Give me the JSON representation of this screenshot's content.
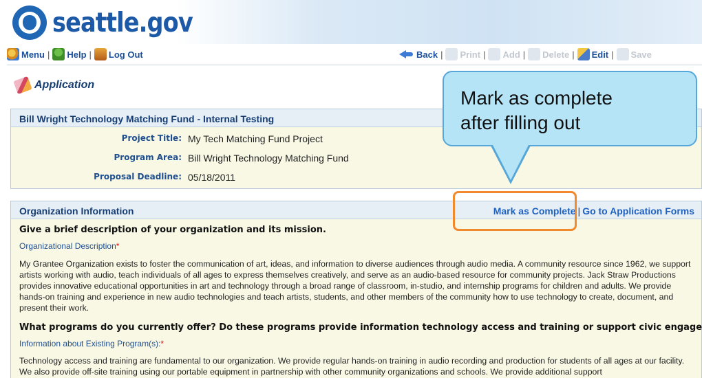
{
  "header": {
    "logo_text": "seattle.gov"
  },
  "toolbar": {
    "menu": "Menu",
    "help": "Help",
    "logout": "Log Out",
    "back": "Back",
    "print": "Print",
    "add": "Add",
    "delete": "Delete",
    "edit": "Edit",
    "save": "Save",
    "separator": "|"
  },
  "page": {
    "heading": "Application"
  },
  "project": {
    "title": "Bill Wright Technology Matching Fund - Internal Testing",
    "fields": [
      {
        "label": "Project Title:",
        "value": "My Tech Matching Fund Project"
      },
      {
        "label": "Program Area:",
        "value": "Bill Wright Technology Matching Fund"
      },
      {
        "label": "Proposal Deadline:",
        "value": "05/18/2011"
      }
    ]
  },
  "organization": {
    "title": "Organization Information",
    "mark_complete": "Mark as Complete",
    "link_separator": "|",
    "go_forms": "Go to Application Forms",
    "q1": "Give a brief description of your organization and its mission.",
    "q1_label": "Organizational Description",
    "required_mark": "*",
    "q1_text": "My Grantee Organization exists to foster the communication of art, ideas, and information to diverse audiences through audio media. A community resource since 1962, we support artists working with audio, teach individuals of all ages to express themselves creatively, and serve as an audio-based resource for community projects. Jack Straw Productions provides innovative educational opportunities in art and technology through a broad range of classroom, in-studio, and internship programs for children and adults. We provide hands-on training and experience in new audio technologies and teach artists, students, and other members of the community how to use technology to create, document, and present their work.",
    "q2": "What programs do you currently offer? Do these programs provide information technology access and training or support civic engagement?",
    "q2_label": "Information about Existing Program(s):",
    "q2_text": "Technology access and training are fundamental to our organization.  We provide regular hands-on training in audio recording and production for students of all ages at our facility.  We also provide off-site training using our portable equipment in partnership with other community organizations and schools. We provide additional support"
  },
  "callout": {
    "line1": "Mark as complete",
    "line2": "after filling out"
  }
}
